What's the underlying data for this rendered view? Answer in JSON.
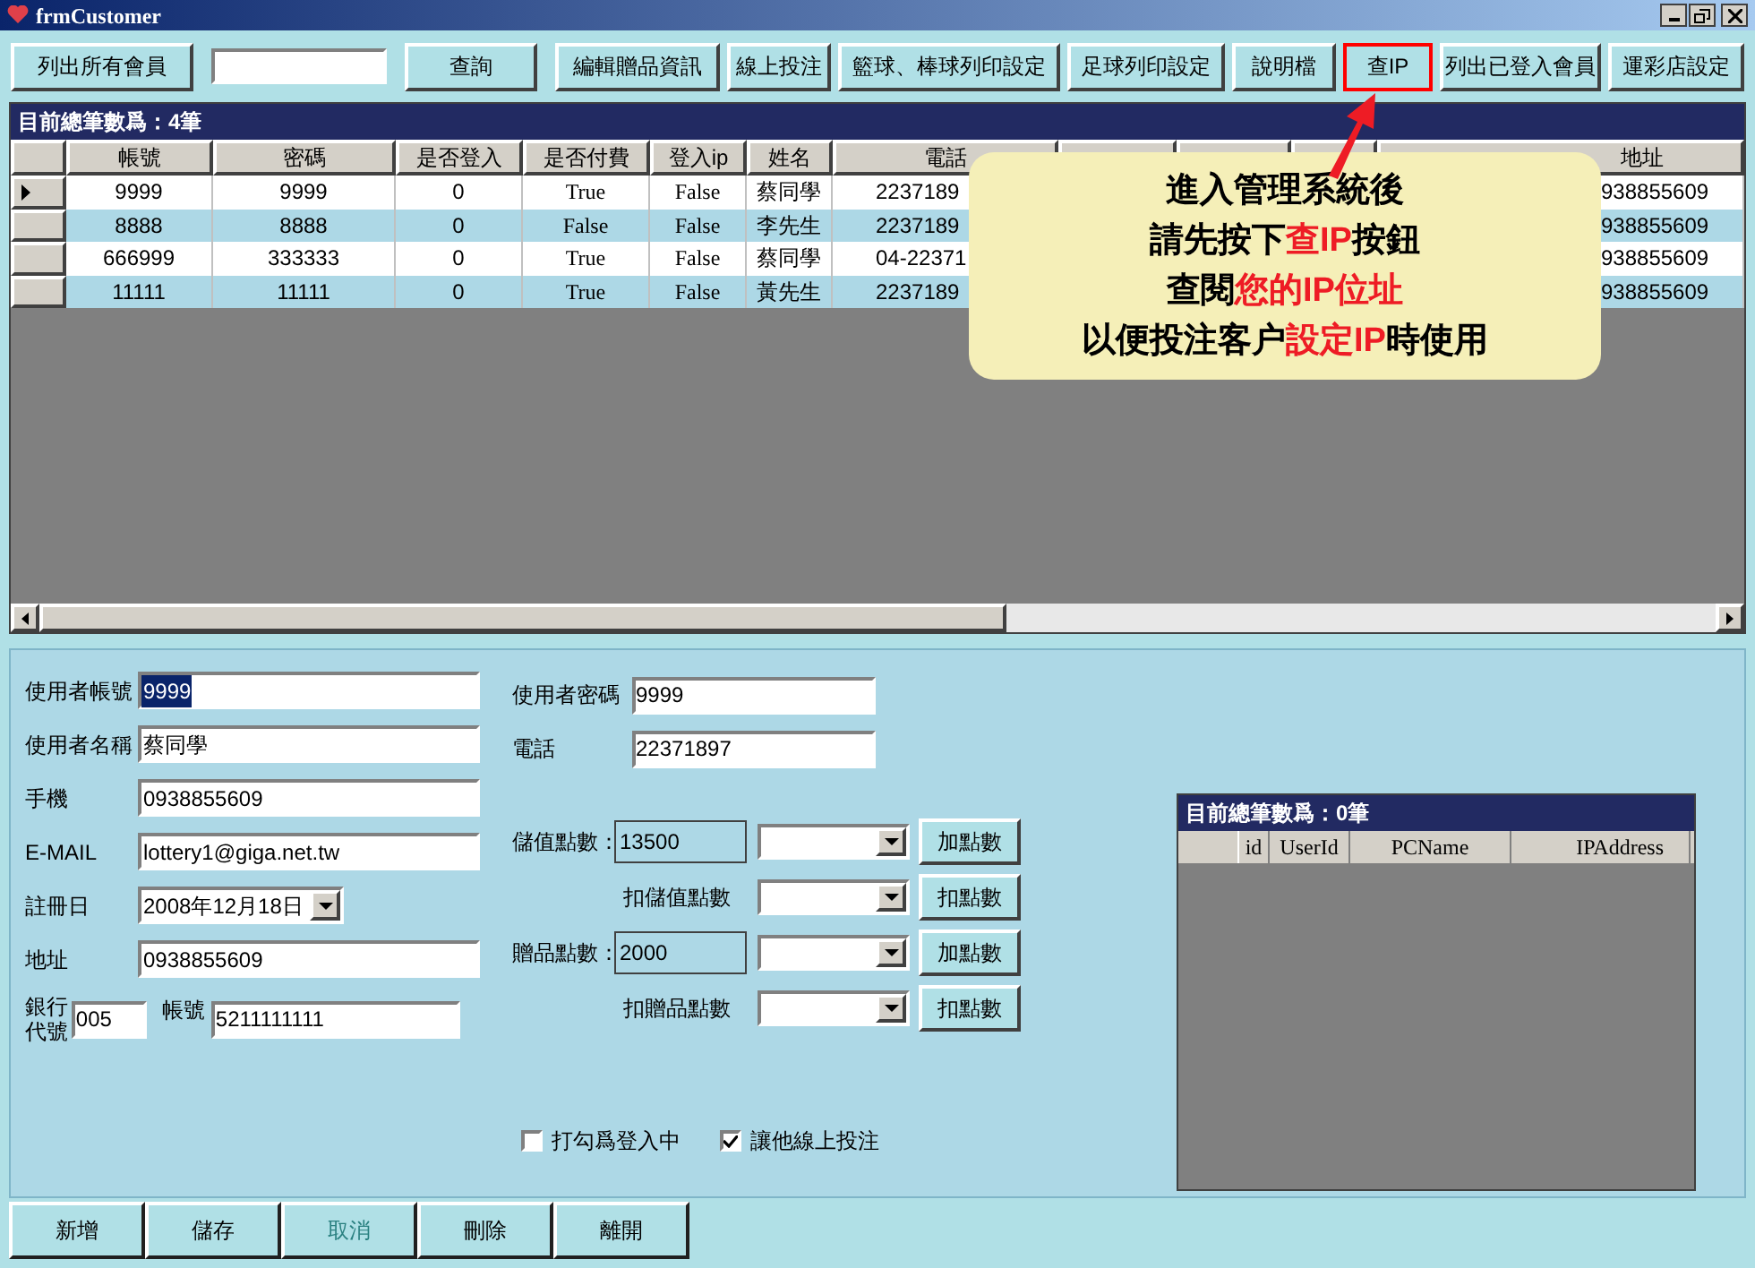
{
  "window": {
    "title": "frmCustomer"
  },
  "toolbar": {
    "buttons": [
      {
        "label": "列出所有會員",
        "highlighted": false
      },
      {
        "kind": "search"
      },
      {
        "label": "查詢",
        "highlighted": false
      },
      {
        "label": "編輯贈品資訊",
        "highlighted": false
      },
      {
        "label": "線上投注",
        "highlighted": false
      },
      {
        "label": "籃球、棒球列印設定",
        "highlighted": false
      },
      {
        "label": "足球列印設定",
        "highlighted": false
      },
      {
        "label": "說明檔",
        "highlighted": false
      },
      {
        "label": "查IP",
        "highlighted": true
      },
      {
        "label": "列出已登入會員",
        "highlighted": false
      },
      {
        "label": "運彩店設定",
        "highlighted": false
      }
    ]
  },
  "members_grid": {
    "caption": "目前總筆數爲：4筆",
    "columns": [
      "帳號",
      "密碼",
      "是否登入",
      "是否付費",
      "登入ip",
      "姓名",
      "電話",
      "地址"
    ],
    "rows": [
      {
        "selected": true,
        "cells": [
          "9999",
          "9999",
          "0",
          "True",
          "False",
          "蔡同學",
          "2237189",
          "938855609"
        ]
      },
      {
        "selected": false,
        "cells": [
          "8888",
          "8888",
          "0",
          "False",
          "False",
          "李先生",
          "2237189",
          "938855609"
        ]
      },
      {
        "selected": false,
        "cells": [
          "666999",
          "333333",
          "0",
          "True",
          "False",
          "蔡同學",
          "04-22371",
          "938855609"
        ]
      },
      {
        "selected": false,
        "cells": [
          "11111",
          "11111",
          "0",
          "True",
          "False",
          "黃先生",
          "2237189",
          "938855609"
        ]
      }
    ]
  },
  "callout": {
    "lines": [
      [
        {
          "text": "進入管理系統後",
          "highlight": false
        }
      ],
      [
        {
          "text": "請先按下",
          "highlight": false
        },
        {
          "text": "查IP",
          "highlight": true
        },
        {
          "text": "按鈕",
          "highlight": false
        }
      ],
      [
        {
          "text": "查閱",
          "highlight": false
        },
        {
          "text": "您的IP位址",
          "highlight": true
        }
      ],
      [
        {
          "text": "以便投注客户",
          "highlight": false
        },
        {
          "text": "設定IP",
          "highlight": true
        },
        {
          "text": "時使用",
          "highlight": false
        }
      ]
    ]
  },
  "form": {
    "left_fields": [
      {
        "kind": "text",
        "label": "使用者帳號",
        "value": "9999",
        "selected": true
      },
      {
        "kind": "text",
        "label": "使用者名稱",
        "value": "蔡同學",
        "selected": false
      },
      {
        "kind": "text",
        "label": "手機",
        "value": "0938855609",
        "selected": false
      },
      {
        "kind": "text",
        "label": "E-MAIL",
        "value": "lottery1@giga.net.tw",
        "selected": false
      },
      {
        "kind": "date",
        "label": "註冊日",
        "value": "2008年12月18日",
        "selected": false
      },
      {
        "kind": "text",
        "label": "地址",
        "value": "0938855609",
        "selected": false
      }
    ],
    "bank": {
      "label": "銀行代號",
      "code": "005",
      "account_label": "帳號",
      "account": "5211111111"
    },
    "middle_fields": [
      {
        "label": "使用者密碼",
        "value": "9999"
      },
      {
        "label": "電話",
        "value": "22371897"
      }
    ],
    "points": [
      {
        "kind": "display",
        "label": "儲值點數：",
        "value": "13500",
        "button": "加點數"
      },
      {
        "kind": "deduct",
        "label": "扣儲值點數",
        "button": "扣點數"
      },
      {
        "kind": "display",
        "label": "贈品點數：",
        "value": "2000",
        "button": "加點數"
      },
      {
        "kind": "deduct",
        "label": "扣贈品點數",
        "button": "扣點數"
      }
    ],
    "checkboxes": [
      {
        "label": "打勾爲登入中",
        "checked": false
      },
      {
        "label": "讓他線上投注",
        "checked": true
      }
    ]
  },
  "login_grid": {
    "caption": "目前總筆數爲：0筆",
    "columns": [
      "id",
      "UserId",
      "PCName",
      "IPAddress"
    ]
  },
  "bottom_buttons": [
    {
      "label": "新增",
      "disabled": false
    },
    {
      "label": "儲存",
      "disabled": false
    },
    {
      "label": "取消",
      "disabled": true
    },
    {
      "label": "刪除",
      "disabled": false
    },
    {
      "label": "離開",
      "disabled": false
    }
  ]
}
